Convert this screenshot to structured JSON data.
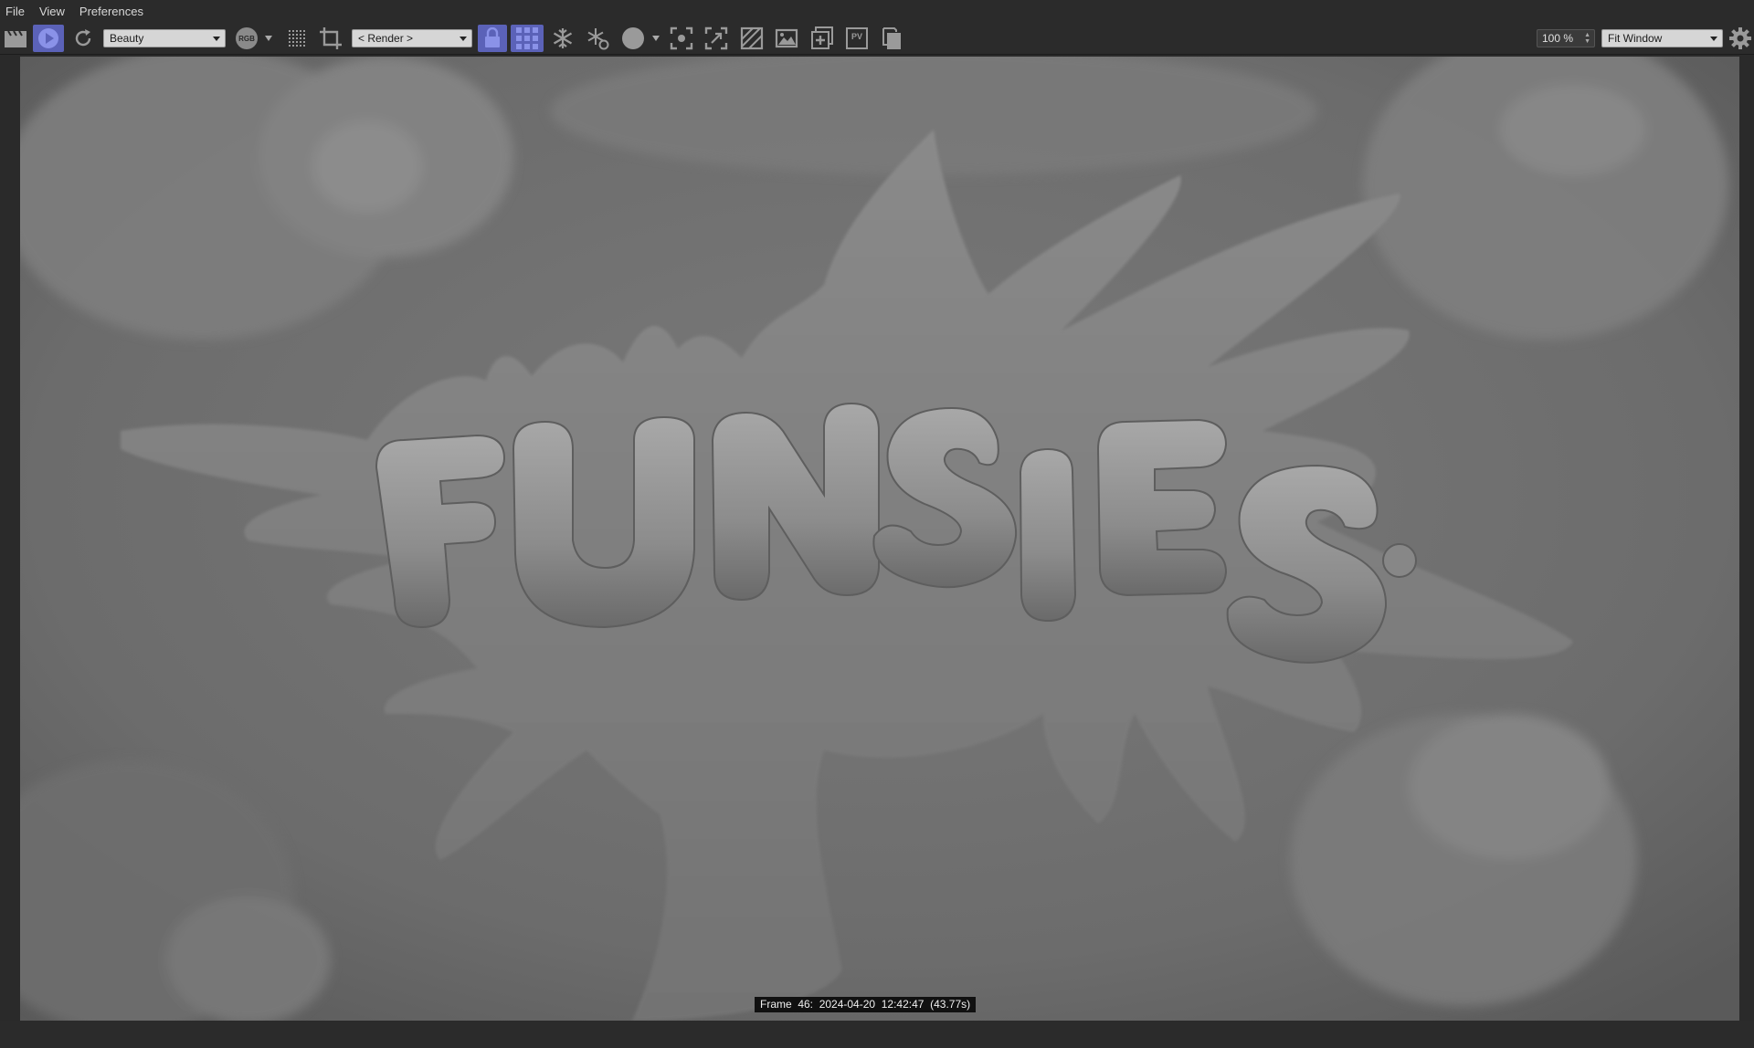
{
  "menu": [
    "File",
    "View",
    "Preferences"
  ],
  "toolbar": {
    "pass_dropdown": "Beauty",
    "render_dropdown": "< Render >",
    "rgb_label": "RGB",
    "pv_label": "PV",
    "zoom_value": "100 %",
    "fit_dropdown": "Fit Window",
    "accent": "#5b62b8"
  },
  "scene": {
    "title_letters": [
      "F",
      "U",
      "N",
      "S",
      "I",
      "E",
      "S"
    ]
  },
  "status": {
    "frame_info": "Frame  46:  2024-04-20  12:42:47  (43.77s)"
  }
}
